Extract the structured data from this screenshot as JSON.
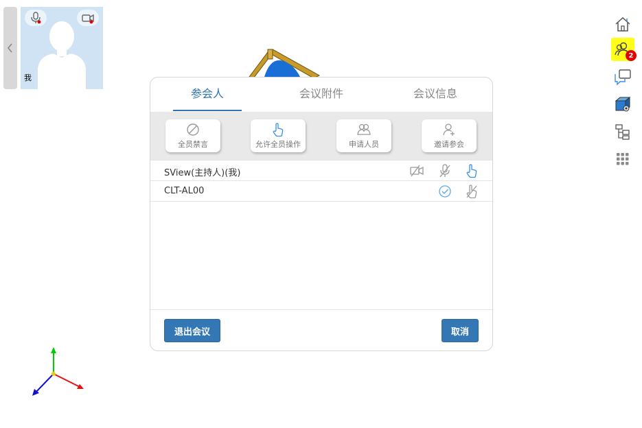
{
  "self_tile": {
    "name": "我",
    "mic_icon": "mic-muted-icon",
    "camera_icon": "camera-off-icon"
  },
  "dialog": {
    "tabs": [
      {
        "label": "参会人",
        "active": true
      },
      {
        "label": "会议附件",
        "active": false
      },
      {
        "label": "会议信息",
        "active": false
      }
    ],
    "actions": [
      {
        "label": "全员禁言",
        "icon": "no-entry-icon"
      },
      {
        "label": "允许全员操作",
        "icon": "hand-pointer-icon"
      },
      {
        "label": "申请人员",
        "icon": "users-icon"
      },
      {
        "label": "邀请参会",
        "icon": "user-add-icon"
      }
    ],
    "participants": [
      {
        "name": "SView(主持人)(我)",
        "icons": [
          "camera-off-icon",
          "mic-off-icon",
          "hand-pointer-icon"
        ]
      },
      {
        "name": "CLT-AL00",
        "icons": [
          "check-circle-icon",
          "hand-off-icon"
        ]
      }
    ],
    "exit_label": "退出会议",
    "cancel_label": "取消"
  },
  "toolbar": {
    "items": [
      "home-icon",
      "participants-icon",
      "chat-icon",
      "model-settings-icon",
      "tree-icon",
      "apps-grid-icon"
    ],
    "participants_badge": "2",
    "active_color": "#ffff1a"
  },
  "colors": {
    "accent": "#2f73b3",
    "button": "#3477b5",
    "badge": "#e60000",
    "tile_bg": "#cfe3f5"
  }
}
